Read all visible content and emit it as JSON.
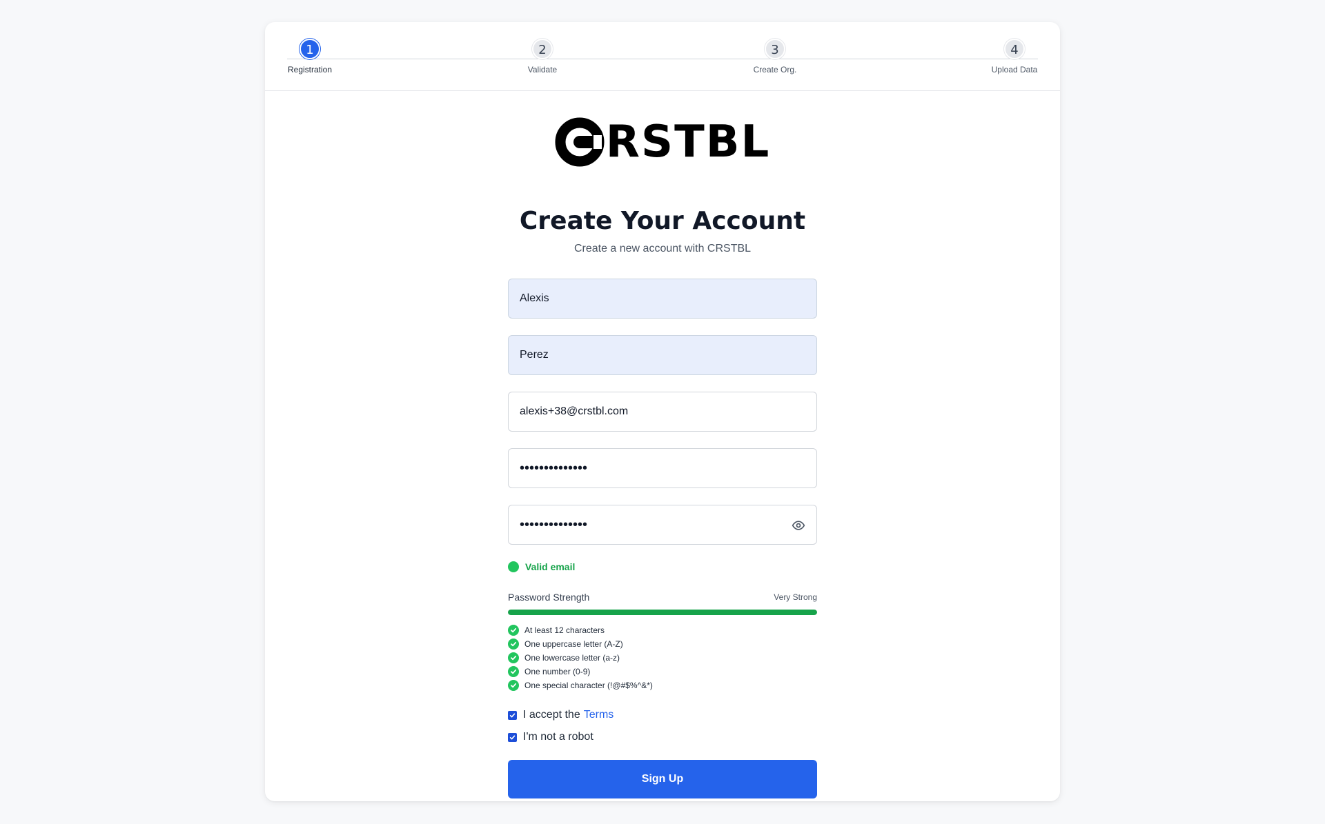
{
  "stepper": {
    "steps": [
      {
        "number": "1",
        "label": "Registration",
        "active": true
      },
      {
        "number": "2",
        "label": "Validate",
        "active": false
      },
      {
        "number": "3",
        "label": "Create Org.",
        "active": false
      },
      {
        "number": "4",
        "label": "Upload Data",
        "active": false
      }
    ]
  },
  "brand": {
    "logo_text": "RSTBL",
    "logo_full": "CRSTBL"
  },
  "header": {
    "title": "Create Your Account",
    "subtitle": "Create a new account with CRSTBL"
  },
  "form": {
    "first_name": "Alexis",
    "last_name": "Perez",
    "email": "alexis+38@crstbl.com",
    "password_mask": "••••••••••••••",
    "confirm_password_mask": "••••••••••••••"
  },
  "email_status": {
    "text": "Valid email",
    "color": "#22c55e"
  },
  "password_strength": {
    "label": "Password Strength",
    "value": "Very Strong",
    "level_percent": 100,
    "color": "#16a34a"
  },
  "requirements": [
    {
      "text": "At least 12 characters",
      "met": true
    },
    {
      "text": "One uppercase letter (A-Z)",
      "met": true
    },
    {
      "text": "One lowercase letter (a-z)",
      "met": true
    },
    {
      "text": "One number (0-9)",
      "met": true
    },
    {
      "text": "One special character (!@#$%^&*)",
      "met": true
    }
  ],
  "checkboxes": {
    "terms_prefix": "I accept the",
    "terms_link": "Terms",
    "terms_checked": true,
    "robot_label": "I'm not a robot",
    "robot_checked": true
  },
  "submit": {
    "label": "Sign Up"
  },
  "colors": {
    "accent": "#2563eb",
    "success": "#22c55e",
    "background": "#f7f8fa"
  }
}
